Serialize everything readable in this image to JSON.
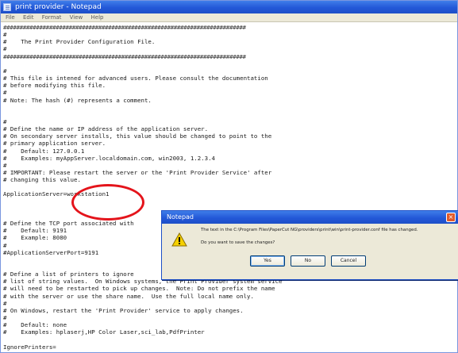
{
  "window": {
    "title": "print provider - Notepad",
    "menu": [
      "File",
      "Edit",
      "Format",
      "View",
      "Help"
    ]
  },
  "document": {
    "lines": [
      "##########################################################################",
      "#",
      "#    The Print Provider Configuration File.",
      "#",
      "##########################################################################",
      "",
      "#",
      "# This file is intened for advanced users. Please consult the documentation",
      "# before modifying this file.",
      "#",
      "# Note: The hash (#) represents a comment.",
      "",
      "",
      "#",
      "# Define the name or IP address of the application server.",
      "# On secondary server installs, this value should be changed to point to the",
      "# primary application server.",
      "#    Default: 127.0.0.1",
      "#    Examples: myAppServer.localdomain.com, win2003, 1.2.3.4",
      "#",
      "# IMPORTANT: Please restart the server or the 'Print Provider Service' after",
      "# changing this value.",
      "",
      "ApplicationServer=workstation1",
      "",
      "",
      "",
      "# Define the TCP port associated with",
      "#    Default: 9191",
      "#    Example: 8080",
      "#",
      "#ApplicationServerPort=9191",
      "",
      "",
      "# Define a list of printers to ignore",
      "# list of string values.  On Windows systems, the Print Provider system service",
      "# will need to be restarted to pick up changes.  Note: Do not prefix the name",
      "# with the server or use the share name.  Use the full local name only.",
      "#",
      "# On Windows, restart the 'Print Provider' service to apply changes.",
      "#",
      "#    Default: none",
      "#    Examples: hplaserj,HP Color Laser,sci_lab,PdfPrinter",
      "",
      "IgnorePrinters="
    ]
  },
  "dialog": {
    "title": "Notepad",
    "close_glyph": "×",
    "message1": "The text in the C:\\Program Files\\PaperCut NG\\providers\\print\\win\\print-provider.conf file has changed.",
    "message2": "Do you want to save the changes?",
    "buttons": [
      "Yes",
      "No",
      "Cancel"
    ],
    "icon": "warning-icon"
  },
  "annotation": {
    "color": "#e4141b"
  }
}
